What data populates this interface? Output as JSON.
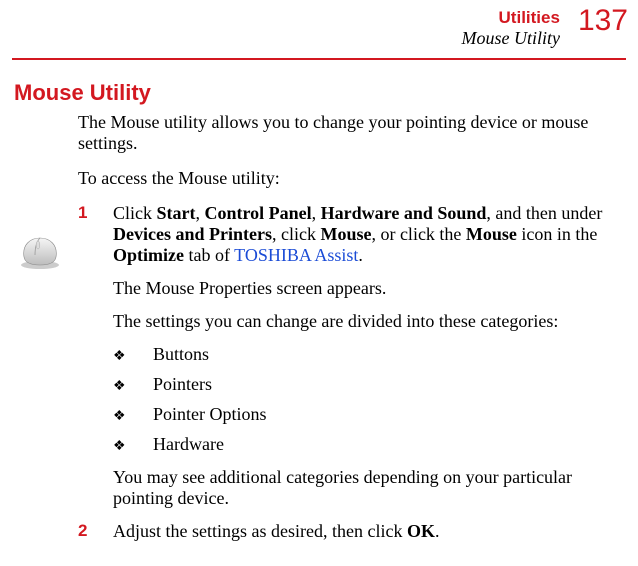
{
  "header": {
    "category": "Utilities",
    "subtitle": "Mouse Utility",
    "page_number": "137"
  },
  "section_title": "Mouse Utility",
  "intro1": "The Mouse utility allows you to change your pointing device or mouse settings.",
  "intro2": "To access the Mouse utility:",
  "step1": {
    "num": "1",
    "t1": "Click ",
    "b1": "Start",
    "t2": ", ",
    "b2": "Control Panel",
    "t3": ", ",
    "b3": "Hardware and Sound",
    "t4": ", and then under ",
    "b4": "Devices and Printers",
    "t5": ", click ",
    "b5": "Mouse",
    "t6": ", or click the ",
    "b6": "Mouse",
    "t7": " icon in the ",
    "b7": "Optimize",
    "t8": " tab of ",
    "link": "TOSHIBA Assist",
    "t9": ".",
    "appears": "The Mouse Properties screen appears.",
    "divided": "The settings you can change are divided into these categories:",
    "bullets": [
      "Buttons",
      "Pointers",
      "Pointer Options",
      "Hardware"
    ],
    "note": "You may see additional categories depending on your particular pointing device."
  },
  "step2": {
    "num": "2",
    "t1": "Adjust the settings as desired, then click ",
    "b1": "OK",
    "t2": "."
  },
  "bullet_char": "❖"
}
